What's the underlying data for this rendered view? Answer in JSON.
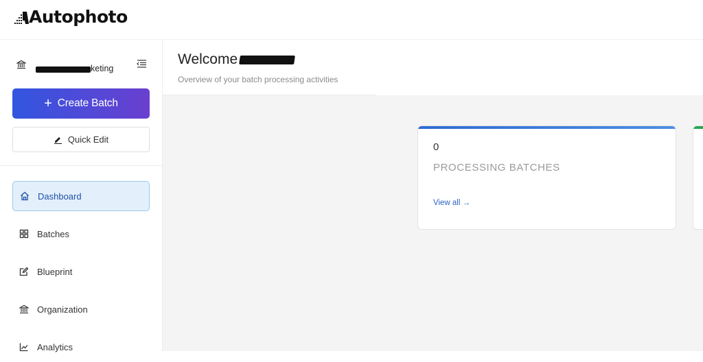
{
  "app": {
    "logo_text": "Autophoto"
  },
  "sidebar": {
    "org_name_suffix": "keting",
    "create_batch_label": "Create Batch",
    "create_batch_plus": "+",
    "quick_edit_label": "Quick Edit",
    "nav": [
      {
        "label": "Dashboard",
        "icon": "home-icon",
        "active": true
      },
      {
        "label": "Batches",
        "icon": "grid-icon",
        "active": false
      },
      {
        "label": "Blueprint",
        "icon": "edit-icon",
        "active": false
      },
      {
        "label": "Organization",
        "icon": "bank-icon",
        "active": false
      },
      {
        "label": "Analytics",
        "icon": "chart-icon",
        "active": false
      }
    ]
  },
  "header": {
    "welcome": "Welcome",
    "subtitle": "Overview of your batch processing activities"
  },
  "cards": [
    {
      "count": "0",
      "label": "PROCESSING BATCHES",
      "link": "View all →",
      "accent": "#2f6bd1"
    },
    {
      "accent": "#2aa65a"
    }
  ],
  "colors": {
    "primary_gradient_start": "#3256e0",
    "primary_gradient_end": "#6a3fcf",
    "active_nav_bg": "#e3f0fb",
    "link": "#2f63c7"
  }
}
